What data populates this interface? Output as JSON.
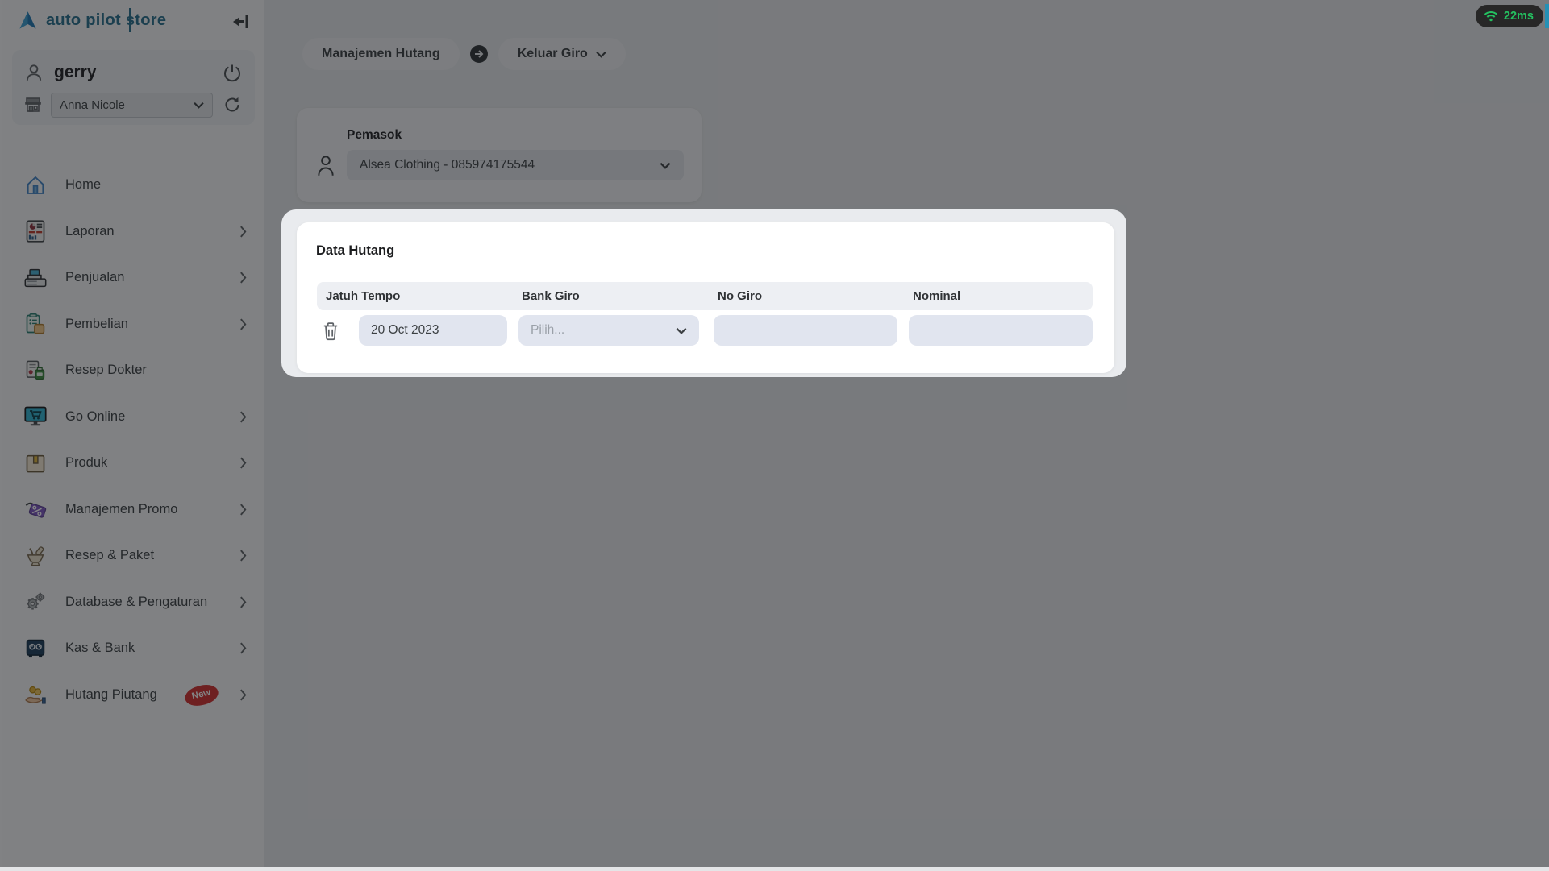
{
  "app": {
    "logo_text": "auto pilot store",
    "latency": "22ms"
  },
  "colors": {
    "brand": "#27708f",
    "latency_green": "#24c060",
    "badge_red": "#d32f2f",
    "input_bg": "#e1e5ef",
    "overlay": "rgba(18,19,21,0.52)"
  },
  "sidebar": {
    "user": {
      "name": "gerry",
      "store_selected": "Anna Nicole"
    },
    "menu": [
      {
        "label": "Home",
        "icon": "home-icon",
        "chevron": false
      },
      {
        "label": "Laporan",
        "icon": "report-icon",
        "chevron": true
      },
      {
        "label": "Penjualan",
        "icon": "cash-register-icon",
        "chevron": true
      },
      {
        "label": "Pembelian",
        "icon": "purchase-clipboard-icon",
        "chevron": true
      },
      {
        "label": "Resep Dokter",
        "icon": "prescription-icon",
        "chevron": false
      },
      {
        "label": "Go Online",
        "icon": "online-store-icon",
        "chevron": true
      },
      {
        "label": "Produk",
        "icon": "product-box-icon",
        "chevron": true
      },
      {
        "label": "Manajemen Promo",
        "icon": "promo-tag-icon",
        "chevron": true
      },
      {
        "label": "Resep & Paket",
        "icon": "mortar-pestle-icon",
        "chevron": true
      },
      {
        "label": "Database & Pengaturan",
        "icon": "gears-icon",
        "chevron": true
      },
      {
        "label": "Kas & Bank",
        "icon": "safe-icon",
        "chevron": true
      },
      {
        "label": "Hutang Piutang",
        "icon": "hand-coins-icon",
        "chevron": true,
        "badge": "New"
      }
    ]
  },
  "breadcrumb": {
    "first": "Manajemen Hutang",
    "second": "Keluar Giro"
  },
  "pemasok": {
    "label": "Pemasok",
    "selected": "Alsea Clothing - 085974175544"
  },
  "data_hutang": {
    "title": "Data Hutang",
    "columns": [
      "Jatuh Tempo",
      "Bank Giro",
      "No Giro",
      "Nominal"
    ],
    "rows": [
      {
        "jatuh_tempo": "20 Oct 2023",
        "bank_giro_placeholder": "Pilih...",
        "no_giro": "",
        "nominal": ""
      }
    ]
  }
}
